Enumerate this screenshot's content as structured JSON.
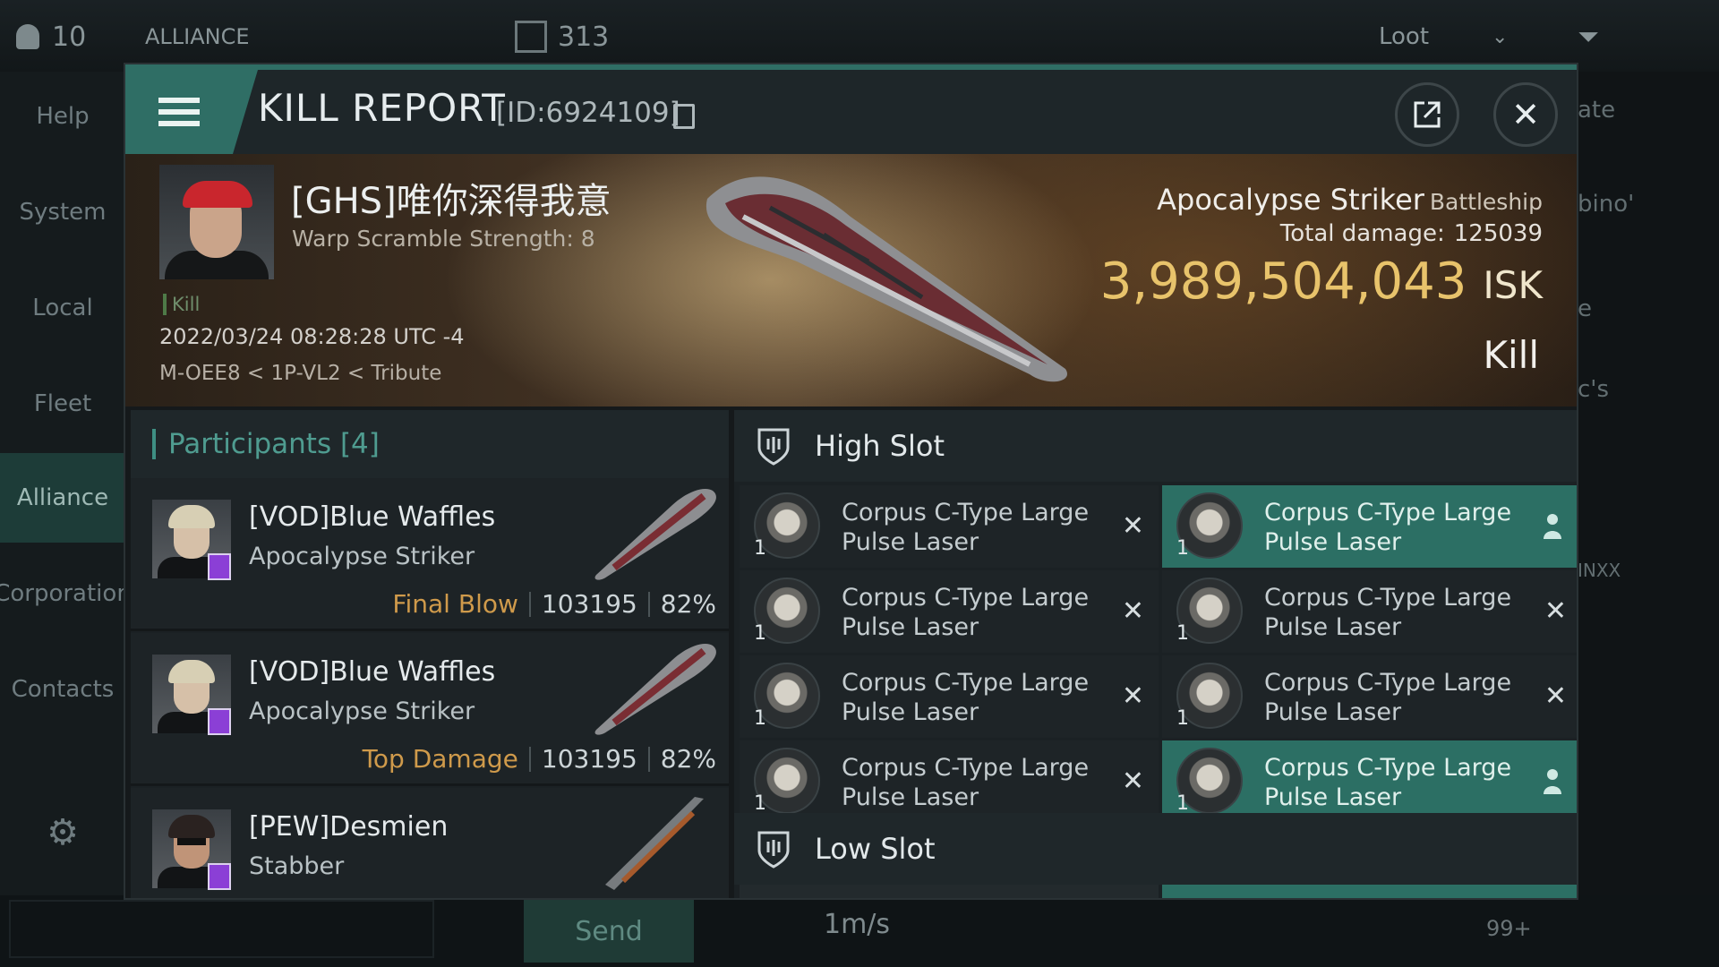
{
  "background": {
    "player_count": "10",
    "alliance_label": "ALLIANCE",
    "alliance_count": "313",
    "loot_label": "Loot",
    "nav": [
      "Help",
      "System",
      "Local",
      "Fleet",
      "Alliance",
      "Corporation",
      "Contacts"
    ],
    "right_fragments": [
      "ate",
      "bino'",
      "e",
      "c's",
      "INXX"
    ],
    "speed": "1m/s",
    "send_label": "Send",
    "badge": "99+"
  },
  "report": {
    "title": "KILL REPORT",
    "id": "[ID:6924109]",
    "victim": {
      "name": "[GHS]唯你深得我意",
      "warp": "Warp Scramble Strength: 8",
      "tag": "Kill",
      "datetime": "2022/03/24 08:28:28 UTC -4",
      "location": "M-OEE8 < 1P-VL2 < Tribute"
    },
    "ship": {
      "name": "Apocalypse Striker",
      "class": "Battleship",
      "total_damage_label": "Total damage:",
      "total_damage": "125039",
      "isk_value": "3,989,504,043",
      "isk_unit": "ISK",
      "result": "Kill"
    },
    "participants": {
      "title": "Participants [4]",
      "rows": [
        {
          "name": "[VOD]Blue Waffles",
          "ship": "Apocalypse Striker",
          "label": "Final Blow",
          "damage": "103195",
          "percent": "82%"
        },
        {
          "name": "[VOD]Blue Waffles",
          "ship": "Apocalypse Striker",
          "label": "Top Damage",
          "damage": "103195",
          "percent": "82%"
        },
        {
          "name": "[PEW]Desmien",
          "ship": "Stabber",
          "label": "",
          "damage": "",
          "percent": ""
        }
      ]
    },
    "high_slot": {
      "title": "High Slot",
      "modules": [
        {
          "name": "Corpus C-Type Large Pulse Laser",
          "qty": "1",
          "state": "destroyed"
        },
        {
          "name": "Corpus C-Type Large Pulse Laser",
          "qty": "1",
          "state": "dropped"
        },
        {
          "name": "Corpus C-Type Large Pulse Laser",
          "qty": "1",
          "state": "destroyed"
        },
        {
          "name": "Corpus C-Type Large Pulse Laser",
          "qty": "1",
          "state": "destroyed"
        },
        {
          "name": "Corpus C-Type Large Pulse Laser",
          "qty": "1",
          "state": "destroyed"
        },
        {
          "name": "Corpus C-Type Large Pulse Laser",
          "qty": "1",
          "state": "destroyed"
        },
        {
          "name": "Corpus C-Type Large Pulse Laser",
          "qty": "1",
          "state": "destroyed"
        },
        {
          "name": "Corpus C-Type Large Pulse Laser",
          "qty": "1",
          "state": "dropped"
        }
      ]
    },
    "low_slot": {
      "title": "Low Slot"
    }
  },
  "colors": {
    "accent": "#2f6e65",
    "isk": "#e8c36b",
    "label": "#cf9a4b"
  }
}
